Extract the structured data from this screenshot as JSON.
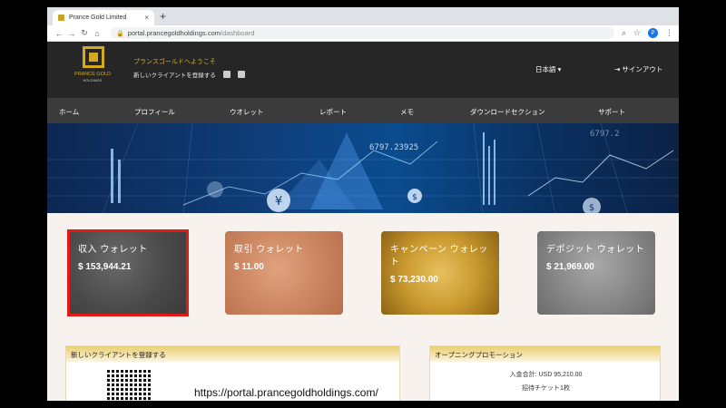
{
  "browser": {
    "tab_title": "Prance Gold Limited",
    "tab_close": "×",
    "new_tab": "+",
    "back": "←",
    "forward": "→",
    "reload": "↻",
    "home": "⌂",
    "lock": "🔒",
    "url_host": "portal.prancegoldholdings.com",
    "url_path": "/dashboard",
    "zoom_icon": "⌕",
    "star_icon": "☆",
    "profile_initial": "P",
    "menu_icon": "⋮"
  },
  "header": {
    "logo_text": "PRANCE GOLD",
    "logo_sub": "HOLDINGS",
    "welcome": "プランスゴールドへようこそ",
    "register_label": "新しいクライアントを登録する",
    "language": "日本語 ▾",
    "signout": "⇥ サインアウト"
  },
  "nav": [
    "ホーム",
    "プロフィール",
    "ウオレット",
    "レポート",
    "メモ",
    "ダウンロードセクション",
    "サポート"
  ],
  "banner": {
    "ticker1": "6797.23925",
    "ticker2": "6797.2"
  },
  "wallets": [
    {
      "name": "収入 ウォレット",
      "amount": "$ 153,944.21"
    },
    {
      "name": "取引 ウォレット",
      "amount": "$ 11.00"
    },
    {
      "name": "キャンペーン ウォレット",
      "amount": "$ 73,230.00"
    },
    {
      "name": "デポジット ウォレット",
      "amount": "$ 21,969.00"
    }
  ],
  "register_panel": {
    "title": "新しいクライアントを登録する",
    "url": "https://portal.prancegoldholdings.com/"
  },
  "promo_panel": {
    "title": "オープニングプロモーション",
    "line1": "入金合計: USD 95,210.00",
    "line2": "招待チケット1枚"
  },
  "colors": {
    "gold": "#d4a820",
    "header_bg": "#262626",
    "nav_bg": "#3b3b3b",
    "highlight": "#e01919"
  }
}
